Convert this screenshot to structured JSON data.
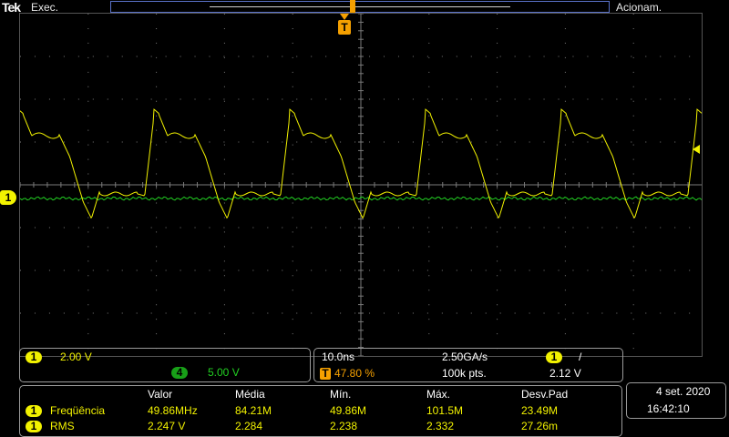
{
  "header": {
    "logo": "Tek",
    "run_state": "Exec.",
    "trigger_state": "Acionam."
  },
  "markers": {
    "trigger_letter": "T",
    "channel1_label": "1"
  },
  "colors": {
    "ch1": "#f2f200",
    "ch4": "#22d022",
    "trigger": "#f5a000",
    "grid": "#7a7a7a"
  },
  "vertical": {
    "ch1_badge": "1",
    "ch1_scale": "2.00 V",
    "ch4_badge": "4",
    "ch4_scale": "5.00 V"
  },
  "horizontal": {
    "time_div": "10.0ns",
    "sample_rate": "2.50GA/s",
    "trig_source": "1",
    "trig_slope": "/",
    "trig_pos_letter": "T",
    "trig_position": "47.80 %",
    "record_length": "100k pts.",
    "trig_level": "2.12 V"
  },
  "measurements": {
    "headers": [
      "Valor",
      "Média",
      "Mín.",
      "Máx.",
      "Desv.Pad"
    ],
    "rows": [
      {
        "badge": "1",
        "name": "Freqüência",
        "values": [
          "49.86MHz",
          "84.21M",
          "49.86M",
          "101.5M",
          "23.49M"
        ]
      },
      {
        "badge": "1",
        "name": "RMS",
        "values": [
          "2.247 V",
          "2.284",
          "2.238",
          "2.332",
          "27.26m"
        ]
      }
    ]
  },
  "datetime": {
    "date": "4 set. 2020",
    "time": "16:42:10"
  }
}
